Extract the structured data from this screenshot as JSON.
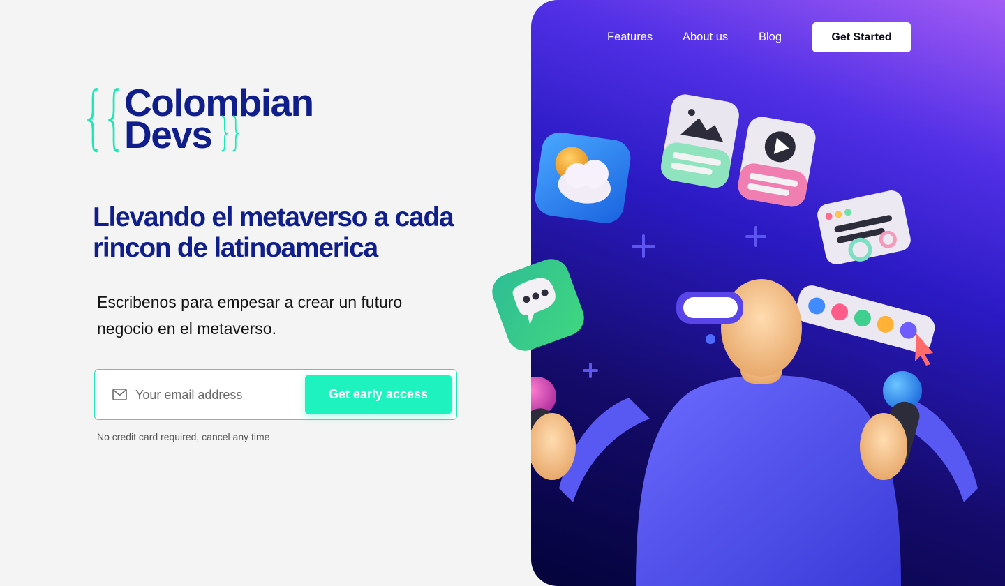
{
  "brand": {
    "line1": "Colombian",
    "line2": "Devs",
    "brace_open": "{",
    "brace_close": "}",
    "color_primary": "#101e8c",
    "color_accent": "#1ee9b6"
  },
  "nav": {
    "items": [
      {
        "label": "Features"
      },
      {
        "label": "About us"
      },
      {
        "label": "Blog"
      }
    ],
    "cta_label": "Get Started"
  },
  "hero": {
    "headline": "Llevando el metaverso a cada rincon de latinoamerica",
    "subtext": "Escribenos para empesar a crear un futuro negocio en el metaverso.",
    "illustration_icons": [
      "weather-card-icon",
      "image-card-icon",
      "play-card-icon",
      "settings-card-icon",
      "color-palette-icon",
      "chat-bubble-icon",
      "vr-headset-person"
    ]
  },
  "signup": {
    "icon": "mail-icon",
    "email_placeholder": "Your email address",
    "email_value": "",
    "submit_label": "Get early access",
    "fineprint": "No credit card required, cancel any time"
  }
}
